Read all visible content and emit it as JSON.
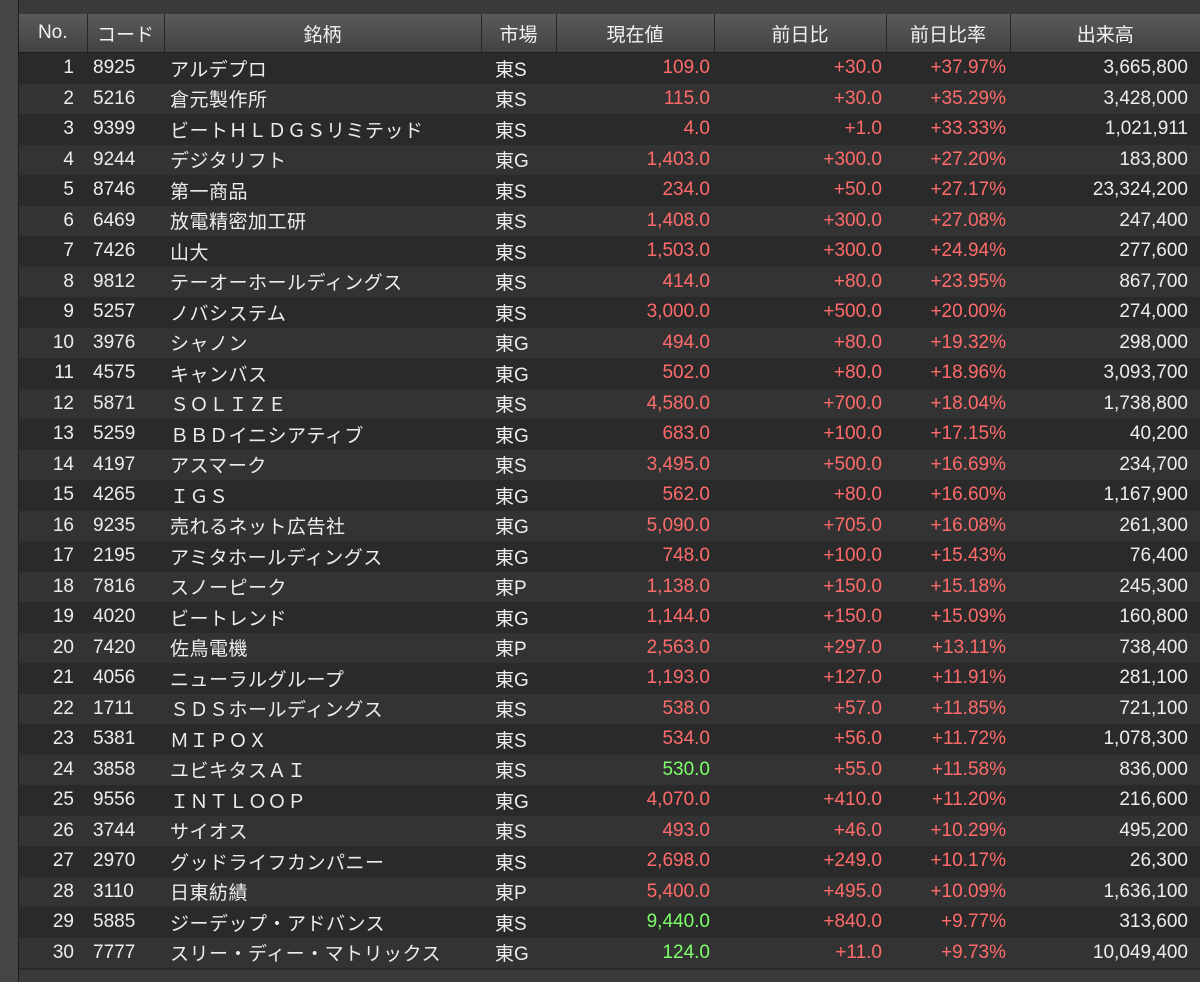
{
  "columns": {
    "no": "No.",
    "code": "コード",
    "name": "銘柄",
    "market": "市場",
    "price": "現在値",
    "change": "前日比",
    "change_pct": "前日比率",
    "volume": "出来高"
  },
  "colors": {
    "up": "#ff6b6b",
    "highlight": "#7dff6a",
    "text": "#ededed",
    "header_bg": "#4d4d4d"
  },
  "rows": [
    {
      "no": "1",
      "code": "8925",
      "name": "アルデプロ",
      "market": "東S",
      "price": "109.0",
      "change": "+30.0",
      "change_pct": "+37.97%",
      "volume": "3,665,800",
      "price_color": "up"
    },
    {
      "no": "2",
      "code": "5216",
      "name": "倉元製作所",
      "market": "東S",
      "price": "115.0",
      "change": "+30.0",
      "change_pct": "+35.29%",
      "volume": "3,428,000",
      "price_color": "up"
    },
    {
      "no": "3",
      "code": "9399",
      "name": "ビートＨＬＤＧＳリミテッド",
      "market": "東S",
      "price": "4.0",
      "change": "+1.0",
      "change_pct": "+33.33%",
      "volume": "1,021,911",
      "price_color": "up"
    },
    {
      "no": "4",
      "code": "9244",
      "name": "デジタリフト",
      "market": "東G",
      "price": "1,403.0",
      "change": "+300.0",
      "change_pct": "+27.20%",
      "volume": "183,800",
      "price_color": "up"
    },
    {
      "no": "5",
      "code": "8746",
      "name": "第一商品",
      "market": "東S",
      "price": "234.0",
      "change": "+50.0",
      "change_pct": "+27.17%",
      "volume": "23,324,200",
      "price_color": "up"
    },
    {
      "no": "6",
      "code": "6469",
      "name": "放電精密加工研",
      "market": "東S",
      "price": "1,408.0",
      "change": "+300.0",
      "change_pct": "+27.08%",
      "volume": "247,400",
      "price_color": "up"
    },
    {
      "no": "7",
      "code": "7426",
      "name": "山大",
      "market": "東S",
      "price": "1,503.0",
      "change": "+300.0",
      "change_pct": "+24.94%",
      "volume": "277,600",
      "price_color": "up"
    },
    {
      "no": "8",
      "code": "9812",
      "name": "テーオーホールディングス",
      "market": "東S",
      "price": "414.0",
      "change": "+80.0",
      "change_pct": "+23.95%",
      "volume": "867,700",
      "price_color": "up"
    },
    {
      "no": "9",
      "code": "5257",
      "name": "ノバシステム",
      "market": "東S",
      "price": "3,000.0",
      "change": "+500.0",
      "change_pct": "+20.00%",
      "volume": "274,000",
      "price_color": "up"
    },
    {
      "no": "10",
      "code": "3976",
      "name": "シャノン",
      "market": "東G",
      "price": "494.0",
      "change": "+80.0",
      "change_pct": "+19.32%",
      "volume": "298,000",
      "price_color": "up"
    },
    {
      "no": "11",
      "code": "4575",
      "name": "キャンバス",
      "market": "東G",
      "price": "502.0",
      "change": "+80.0",
      "change_pct": "+18.96%",
      "volume": "3,093,700",
      "price_color": "up"
    },
    {
      "no": "12",
      "code": "5871",
      "name": "ＳＯＬＩＺＥ",
      "market": "東S",
      "price": "4,580.0",
      "change": "+700.0",
      "change_pct": "+18.04%",
      "volume": "1,738,800",
      "price_color": "up"
    },
    {
      "no": "13",
      "code": "5259",
      "name": "ＢＢＤイニシアティブ",
      "market": "東G",
      "price": "683.0",
      "change": "+100.0",
      "change_pct": "+17.15%",
      "volume": "40,200",
      "price_color": "up"
    },
    {
      "no": "14",
      "code": "4197",
      "name": "アスマーク",
      "market": "東S",
      "price": "3,495.0",
      "change": "+500.0",
      "change_pct": "+16.69%",
      "volume": "234,700",
      "price_color": "up"
    },
    {
      "no": "15",
      "code": "4265",
      "name": "ＩＧＳ",
      "market": "東G",
      "price": "562.0",
      "change": "+80.0",
      "change_pct": "+16.60%",
      "volume": "1,167,900",
      "price_color": "up"
    },
    {
      "no": "16",
      "code": "9235",
      "name": "売れるネット広告社",
      "market": "東G",
      "price": "5,090.0",
      "change": "+705.0",
      "change_pct": "+16.08%",
      "volume": "261,300",
      "price_color": "up"
    },
    {
      "no": "17",
      "code": "2195",
      "name": "アミタホールディングス",
      "market": "東G",
      "price": "748.0",
      "change": "+100.0",
      "change_pct": "+15.43%",
      "volume": "76,400",
      "price_color": "up"
    },
    {
      "no": "18",
      "code": "7816",
      "name": "スノーピーク",
      "market": "東P",
      "price": "1,138.0",
      "change": "+150.0",
      "change_pct": "+15.18%",
      "volume": "245,300",
      "price_color": "up"
    },
    {
      "no": "19",
      "code": "4020",
      "name": "ビートレンド",
      "market": "東G",
      "price": "1,144.0",
      "change": "+150.0",
      "change_pct": "+15.09%",
      "volume": "160,800",
      "price_color": "up"
    },
    {
      "no": "20",
      "code": "7420",
      "name": "佐鳥電機",
      "market": "東P",
      "price": "2,563.0",
      "change": "+297.0",
      "change_pct": "+13.11%",
      "volume": "738,400",
      "price_color": "up"
    },
    {
      "no": "21",
      "code": "4056",
      "name": "ニューラルグループ",
      "market": "東G",
      "price": "1,193.0",
      "change": "+127.0",
      "change_pct": "+11.91%",
      "volume": "281,100",
      "price_color": "up"
    },
    {
      "no": "22",
      "code": "1711",
      "name": "ＳＤＳホールディングス",
      "market": "東S",
      "price": "538.0",
      "change": "+57.0",
      "change_pct": "+11.85%",
      "volume": "721,100",
      "price_color": "up"
    },
    {
      "no": "23",
      "code": "5381",
      "name": "ＭＩＰＯＸ",
      "market": "東S",
      "price": "534.0",
      "change": "+56.0",
      "change_pct": "+11.72%",
      "volume": "1,078,300",
      "price_color": "up"
    },
    {
      "no": "24",
      "code": "3858",
      "name": "ユビキタスＡＩ",
      "market": "東S",
      "price": "530.0",
      "change": "+55.0",
      "change_pct": "+11.58%",
      "volume": "836,000",
      "price_color": "highlight"
    },
    {
      "no": "25",
      "code": "9556",
      "name": "ＩＮＴＬＯＯＰ",
      "market": "東G",
      "price": "4,070.0",
      "change": "+410.0",
      "change_pct": "+11.20%",
      "volume": "216,600",
      "price_color": "up"
    },
    {
      "no": "26",
      "code": "3744",
      "name": "サイオス",
      "market": "東S",
      "price": "493.0",
      "change": "+46.0",
      "change_pct": "+10.29%",
      "volume": "495,200",
      "price_color": "up"
    },
    {
      "no": "27",
      "code": "2970",
      "name": "グッドライフカンパニー",
      "market": "東S",
      "price": "2,698.0",
      "change": "+249.0",
      "change_pct": "+10.17%",
      "volume": "26,300",
      "price_color": "up"
    },
    {
      "no": "28",
      "code": "3110",
      "name": "日東紡績",
      "market": "東P",
      "price": "5,400.0",
      "change": "+495.0",
      "change_pct": "+10.09%",
      "volume": "1,636,100",
      "price_color": "up"
    },
    {
      "no": "29",
      "code": "5885",
      "name": "ジーデップ・アドバンス",
      "market": "東S",
      "price": "9,440.0",
      "change": "+840.0",
      "change_pct": "+9.77%",
      "volume": "313,600",
      "price_color": "highlight"
    },
    {
      "no": "30",
      "code": "7777",
      "name": "スリー・ディー・マトリックス",
      "market": "東G",
      "price": "124.0",
      "change": "+11.0",
      "change_pct": "+9.73%",
      "volume": "10,049,400",
      "price_color": "highlight"
    }
  ]
}
